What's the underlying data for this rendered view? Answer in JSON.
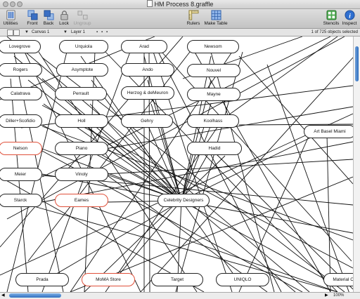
{
  "window": {
    "title": "HM Process 8.graffle"
  },
  "toolbar": {
    "utilities": "Utilities",
    "front": "Front",
    "back": "Back",
    "lock": "Lock",
    "ungroup": "Ungroup",
    "rulers": "Rulers",
    "make_table": "Make Table",
    "stencils": "Stencils",
    "inspect": "Inspect"
  },
  "subbar": {
    "canvas": "Canvas 1",
    "layer": "Layer 1",
    "selection": "1 of 725 objects selected"
  },
  "statusbar": {
    "zoom": "100%"
  },
  "nodes": [
    {
      "label": "Lovegrove",
      "red": false
    },
    {
      "label": "Urquiola",
      "red": false
    },
    {
      "label": "Arad",
      "red": false
    },
    {
      "label": "Newsom",
      "red": false
    },
    {
      "label": "Rogers",
      "red": false
    },
    {
      "label": "Asymptote",
      "red": false
    },
    {
      "label": "Ando",
      "red": false
    },
    {
      "label": "Nouvel",
      "red": false
    },
    {
      "label": "Calatrava",
      "red": false
    },
    {
      "label": "Perrault",
      "red": false
    },
    {
      "label": "Herzog & deMeuron",
      "red": false
    },
    {
      "label": "Mayne",
      "red": false
    },
    {
      "label": "Diller+Scofidio",
      "red": false
    },
    {
      "label": "Holl",
      "red": false
    },
    {
      "label": "Gehry",
      "red": false
    },
    {
      "label": "Koolhass",
      "red": false
    },
    {
      "label": "Art Basel Miami",
      "red": false
    },
    {
      "label": "Nelson",
      "red": true
    },
    {
      "label": "Piano",
      "red": false
    },
    {
      "label": "Hadid",
      "red": false
    },
    {
      "label": "Meier",
      "red": false
    },
    {
      "label": "Vinoly",
      "red": false
    },
    {
      "label": "Starck",
      "red": false
    },
    {
      "label": "Eames",
      "red": true
    },
    {
      "label": "Celebrity Designers",
      "red": false
    },
    {
      "label": "Prada",
      "red": false
    },
    {
      "label": "MoMA Store",
      "red": true
    },
    {
      "label": "Target",
      "red": false
    },
    {
      "label": "UNIQLO",
      "red": false
    },
    {
      "label": "Material Co",
      "red": false
    }
  ]
}
